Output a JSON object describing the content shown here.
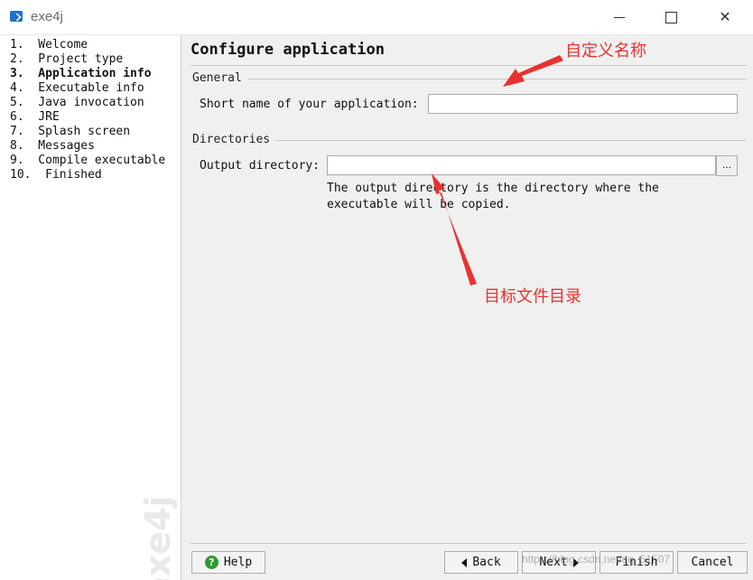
{
  "window": {
    "title": "exe4j",
    "minimize_glyph": "",
    "maximize_glyph": "",
    "close_glyph": "✕"
  },
  "sidebar": {
    "steps": [
      "1.  Welcome",
      "2.  Project type",
      "3.  Application info",
      "4.  Executable info",
      "5.  Java invocation",
      "6.  JRE",
      "7.  Splash screen",
      "8.  Messages",
      "9.  Compile executable",
      "10.  Finished"
    ],
    "active_index": 2,
    "watermark": "exe4j"
  },
  "main": {
    "title": "Configure application",
    "general": {
      "heading": "General",
      "short_name_label": "Short name of your application:",
      "short_name_value": ""
    },
    "directories": {
      "heading": "Directories",
      "output_label": "Output directory:",
      "output_value": "",
      "browse_label": "...",
      "hint_line1": "The output directory is the directory where the",
      "hint_line2": "executable will be copied."
    }
  },
  "buttons": {
    "help": "Help",
    "back": "Back",
    "next": "Next",
    "finish": "Finish",
    "cancel": "Cancel"
  },
  "annotations": {
    "name_note": "自定义名称",
    "dir_note": "目标文件目录",
    "color": "#e8322f"
  },
  "watermark_url": "https://blog.csdn.net/qq_51507"
}
